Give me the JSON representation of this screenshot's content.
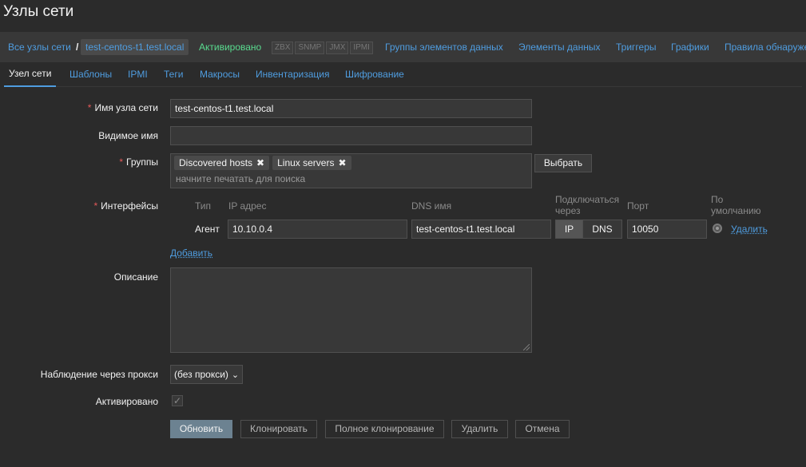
{
  "page": {
    "title": "Узлы сети"
  },
  "breadcrumb": {
    "all_hosts": "Все узлы сети",
    "separator": "/",
    "current": "test-centos-t1.test.local",
    "status": "Активировано",
    "availability": [
      "ZBX",
      "SNMP",
      "JMX",
      "IPMI"
    ],
    "links": [
      "Группы элементов данных",
      "Элементы данных",
      "Триггеры",
      "Графики",
      "Правила обнаружения"
    ]
  },
  "tabs": [
    "Узел сети",
    "Шаблоны",
    "IPMI",
    "Теги",
    "Макросы",
    "Инвентаризация",
    "Шифрование"
  ],
  "form": {
    "required_mark": "*",
    "hostname": {
      "label": "Имя узла сети",
      "value": "test-centos-t1.test.local"
    },
    "visible_name": {
      "label": "Видимое имя",
      "value": ""
    },
    "groups": {
      "label": "Группы",
      "items": [
        "Discovered hosts",
        "Linux servers"
      ],
      "remove_glyph": "✖",
      "placeholder": "начните печатать для поиска",
      "select_button": "Выбрать"
    },
    "interfaces": {
      "label": "Интерфейсы",
      "headers": {
        "type": "Тип",
        "ip": "IP адрес",
        "dns": "DNS имя",
        "connect_line1": "Подключаться",
        "connect_line2": "через",
        "port": "Порт",
        "default_line1": "По",
        "default_line2": "умолчанию"
      },
      "row": {
        "type": "Агент",
        "ip": "10.10.0.4",
        "dns": "test-centos-t1.test.local",
        "connect_ip": "IP",
        "connect_dns": "DNS",
        "port": "10050",
        "remove": "Удалить"
      },
      "add": "Добавить"
    },
    "description": {
      "label": "Описание",
      "value": ""
    },
    "proxy": {
      "label": "Наблюдение через прокси",
      "value": "(без прокси)",
      "chevron": "⌄"
    },
    "enabled": {
      "label": "Активировано",
      "check": "✓"
    }
  },
  "buttons": {
    "update": "Обновить",
    "clone": "Клонировать",
    "full_clone": "Полное клонирование",
    "delete": "Удалить",
    "cancel": "Отмена"
  },
  "colors": {
    "accent": "#4f9de0",
    "enabled": "#59db8f",
    "required": "#e45959",
    "primary_button": "#6c8291"
  }
}
